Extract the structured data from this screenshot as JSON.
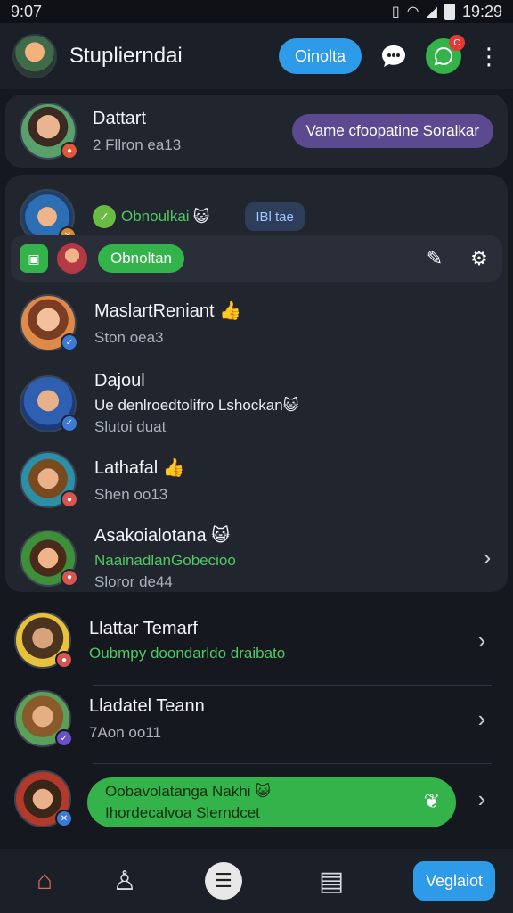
{
  "status_bar": {
    "time": "9:07",
    "clock": "19:29"
  },
  "header": {
    "title": "Stuplierndai",
    "action_button": "Oinolta",
    "badge": "C"
  },
  "pinned": {
    "name": "Dattart",
    "sub": "2 Fllron ea13",
    "pill": "Vame cfoopatine Soralkar"
  },
  "group": {
    "name": "Obnoulkai",
    "chip": "IBl tae",
    "action_pill": "Obnoltan"
  },
  "chats": [
    {
      "name": "MaslartReniant",
      "line2": "",
      "line3": "Ston oea3",
      "emoji": "👍"
    },
    {
      "name": "Dajoul",
      "line2": "Ue denlroedtolifro Lshockan",
      "line3": "Slutoi duat",
      "emoji": "😺"
    },
    {
      "name": "Lathafal",
      "line2": "",
      "line3": "Shen oo13",
      "emoji": "👍"
    },
    {
      "name": "Asakoialotana",
      "line2": "NaainadlanGobecioo",
      "line3": "Sloror de44",
      "emoji": "😺"
    },
    {
      "name": "Llattar Temarf",
      "line2": "Oubmpy doondarldo draibato",
      "line3": "",
      "emoji": ""
    },
    {
      "name": "Lladatel Teann",
      "line2": "",
      "line3": "7Aon oo11",
      "emoji": ""
    }
  ],
  "banner": {
    "line1": "Oobavolatanga Nakhi",
    "line2": "Ihordecalvoa Slerndcet"
  },
  "bottom_nav": {
    "cta": "Veglaiot"
  },
  "icons": [
    "home-icon",
    "profile-icon",
    "menu-icon",
    "clipboard-icon",
    "chat-bubble-icon",
    "whatsapp-icon",
    "more-icon",
    "chevron-right-icon",
    "edit-icon",
    "settings-icon",
    "leaf-icon"
  ],
  "colors": {
    "accent_blue": "#2e9be8",
    "accent_green": "#33b34a",
    "accent_purple": "#5b4a8f",
    "bg": "#15181f"
  }
}
